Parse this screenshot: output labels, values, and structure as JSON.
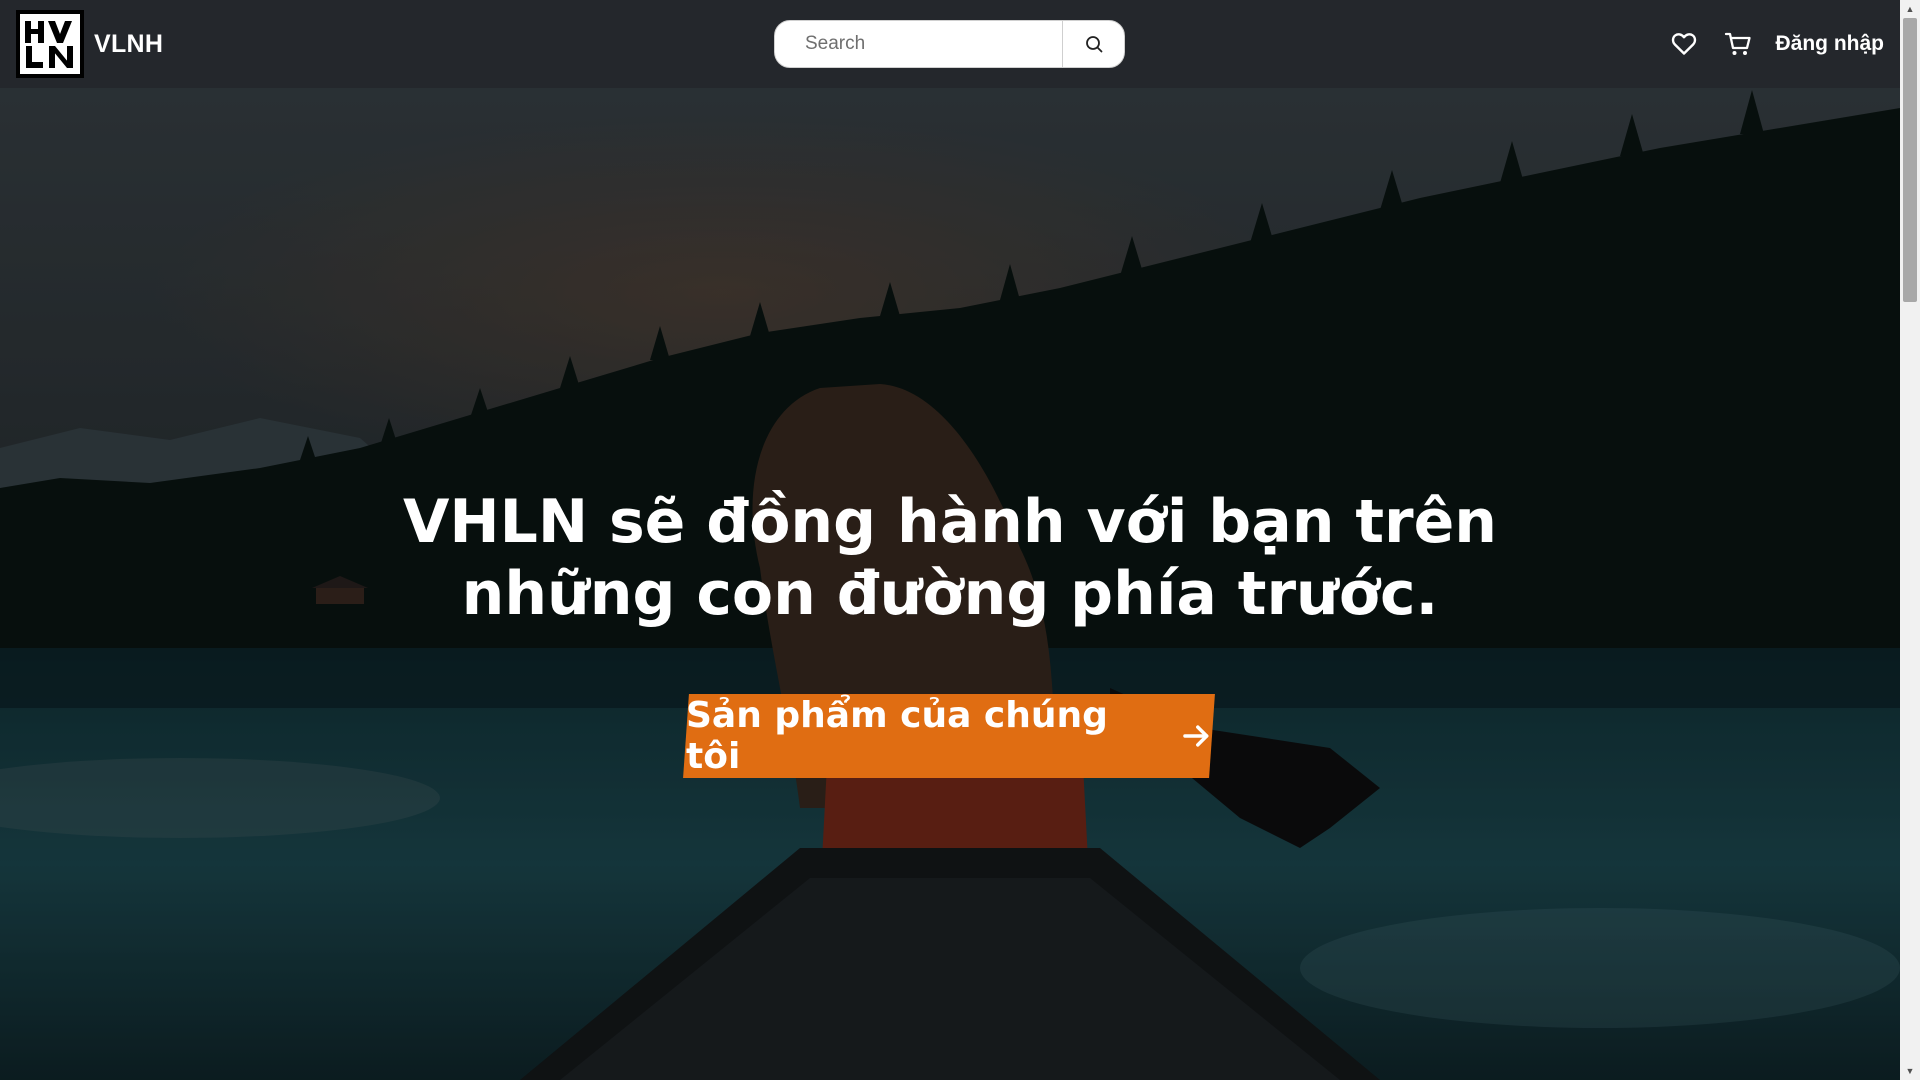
{
  "header": {
    "brand_name": "VLNH",
    "logo_text": "HV LN",
    "search": {
      "placeholder": "Search",
      "value": ""
    },
    "icons": [
      "heart-icon",
      "cart-icon",
      "search-icon"
    ],
    "login_label": "Đăng nhập"
  },
  "hero": {
    "heading_line1": "VHLN sẽ đồng hành với bạn trên",
    "heading_line2": "những con đường phía trước.",
    "cta_label": "Sản phẩm của chúng tôi",
    "cta_icon": "arrow-right-icon"
  },
  "colors": {
    "navbar_bg": "#24272c",
    "cta_bg": "#e06d12",
    "text": "#ffffff"
  }
}
